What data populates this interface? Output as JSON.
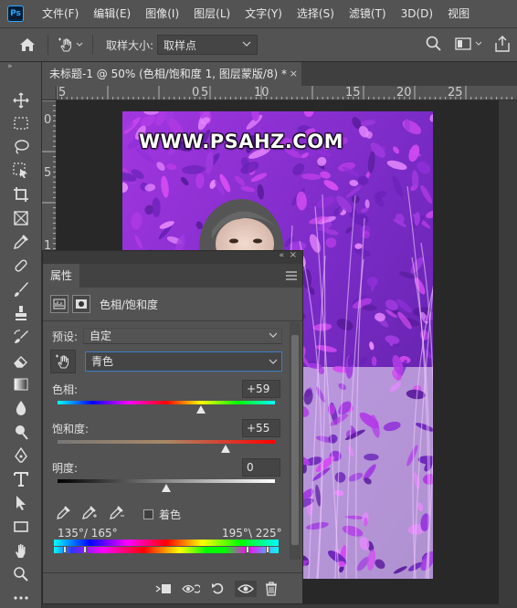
{
  "app": {
    "logo_text": "Ps"
  },
  "menu": [
    "文件(F)",
    "编辑(E)",
    "图像(I)",
    "图层(L)",
    "文字(Y)",
    "选择(S)",
    "滤镜(T)",
    "3D(D)",
    "视图"
  ],
  "options_bar": {
    "sample_size_label": "取样大小:",
    "sample_size_value": "取样点"
  },
  "document_tab": {
    "title": "未标题-1 @ 50% (色相/饱和度 1, 图层蒙版/8) *",
    "close": "×"
  },
  "ruler": {
    "horizontal": [
      "5",
      "0",
      "5",
      "10",
      "15",
      "20",
      "25"
    ],
    "vertical": [
      "0",
      "5",
      "1"
    ]
  },
  "canvas": {
    "watermark": "WWW.PSAHZ.COM"
  },
  "properties": {
    "tab_label": "属性",
    "adjustment_title": "色相/饱和度",
    "preset_label": "预设:",
    "preset_value": "自定",
    "channel_value": "青色",
    "hue_label": "色相:",
    "hue_value": "+59",
    "hue_level": 0.66,
    "saturation_label": "饱和度:",
    "saturation_value": "+55",
    "saturation_level": 0.775,
    "lightness_label": "明度:",
    "lightness_value": "0",
    "lightness_level": 0.5,
    "colorize_label": "着色",
    "colorize_checked": false,
    "range_left": "135°/ 165°",
    "range_right": "195°\\ 225°"
  },
  "colors": {
    "panel_bg": "#535353",
    "canvas_bg": "#282828",
    "active_border": "#3d7cc9",
    "photo_purple": "#8e2fd6",
    "photo_magenta": "#d34bf0"
  }
}
